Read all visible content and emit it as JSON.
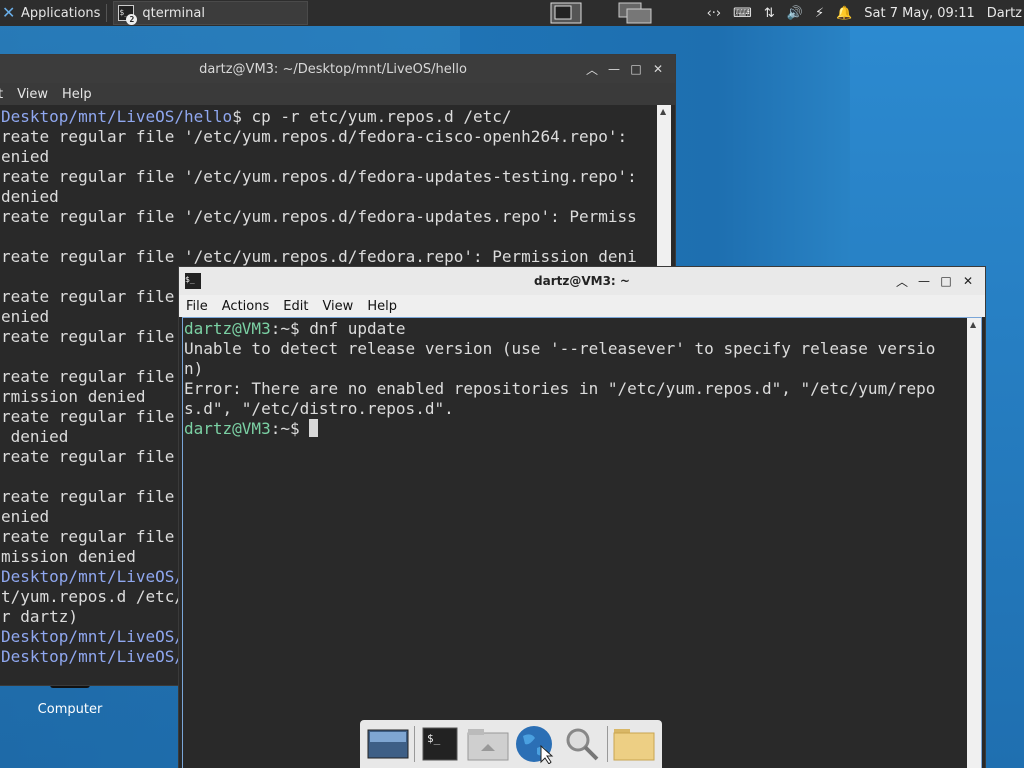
{
  "panel": {
    "applications_label": "Applications",
    "task_label": "qterminal",
    "task_badge": "2",
    "clock": "Sat  7 May, 09:11",
    "user": "Dartz"
  },
  "back_window": {
    "title": "dartz@VM3: ~/Desktop/mnt/LiveOS/hello",
    "menu": [
      "t",
      "View",
      "Help"
    ]
  },
  "front_window": {
    "title": "dartz@VM3: ~",
    "menu": [
      "File",
      "Actions",
      "Edit",
      "View",
      "Help"
    ]
  },
  "back_lines": [
    {
      "path": "Desktop/mnt/LiveOS/hello",
      "text": "$ cp -r etc/yum.repos.d /etc/"
    },
    {
      "text": "reate regular file '/etc/yum.repos.d/fedora-cisco-openh264.repo':"
    },
    {
      "text": "enied"
    },
    {
      "text": "reate regular file '/etc/yum.repos.d/fedora-updates-testing.repo':"
    },
    {
      "text": "denied"
    },
    {
      "text": "reate regular file '/etc/yum.repos.d/fedora-updates.repo': Permiss"
    },
    {
      "text": ""
    },
    {
      "text": "reate regular file '/etc/yum.repos.d/fedora.repo': Permission deni"
    },
    {
      "text": ""
    },
    {
      "text": "reate regular file"
    },
    {
      "text": "enied"
    },
    {
      "text": "reate regular file"
    },
    {
      "text": ""
    },
    {
      "text": "reate regular file"
    },
    {
      "text": "rmission denied"
    },
    {
      "text": "reate regular file"
    },
    {
      "text": " denied"
    },
    {
      "text": "reate regular file"
    },
    {
      "text": ""
    },
    {
      "text": "reate regular file"
    },
    {
      "text": "enied"
    },
    {
      "text": "reate regular file"
    },
    {
      "text": "mission denied"
    },
    {
      "path": "Desktop/mnt/LiveOS/",
      "text": ""
    },
    {
      "text": "t/yum.repos.d /etc/"
    },
    {
      "text": "r dartz)"
    },
    {
      "path": "Desktop/mnt/LiveOS/",
      "text": ""
    },
    {
      "path": "Desktop/mnt/LiveOS/",
      "text": ""
    }
  ],
  "front_lines": {
    "prompt_user": "dartz@VM3",
    "prompt_sep": ":~$ ",
    "command": "dnf update",
    "out1": "Unable to detect release version (use '--releasever' to specify release versio",
    "out2": "n)",
    "out3": "Error: There are no enabled repositories in \"/etc/yum.repos.d\", \"/etc/yum/repo",
    "out4": "s.d\", \"/etc/distro.repos.d\".",
    "prompt2_sep": ":~$ "
  },
  "desktop_icon_label": "Computer",
  "colors": {
    "prompt": "#7bd1a4",
    "path": "#8fa7ef",
    "desktop": "#1e6aa8"
  }
}
